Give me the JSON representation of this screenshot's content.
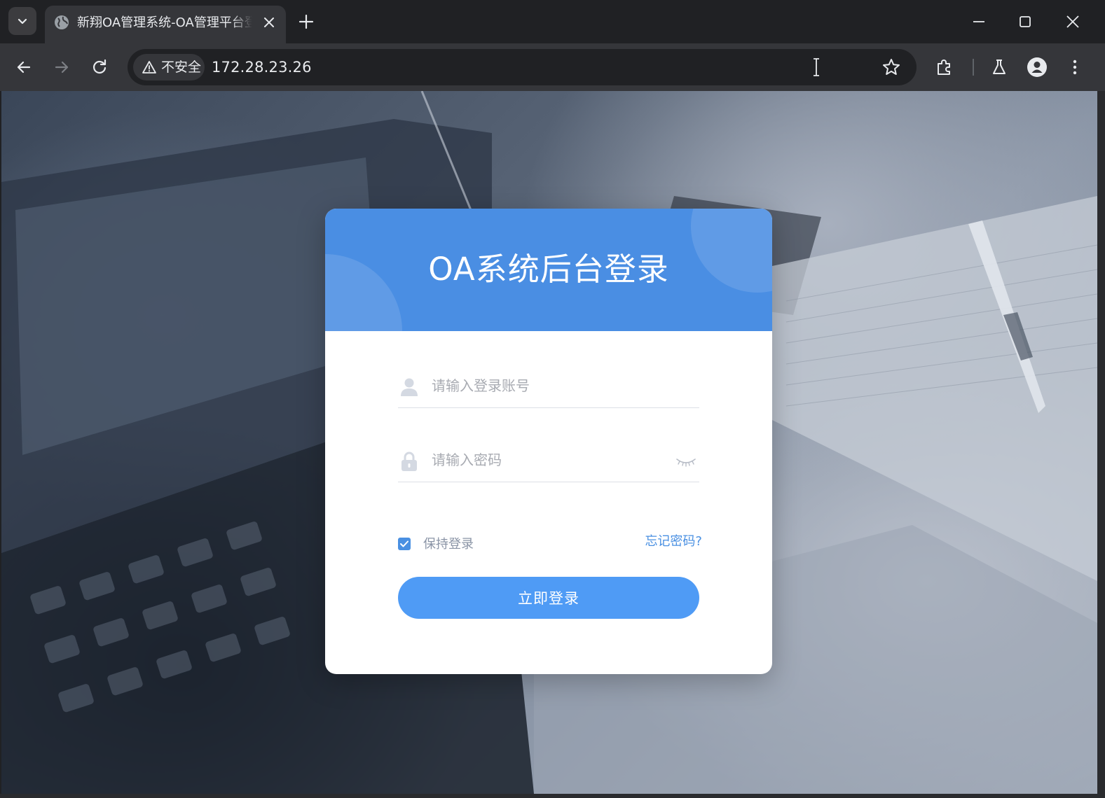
{
  "browser": {
    "tab": {
      "title": "新翔OA管理系统-OA管理平台登录"
    },
    "address_bar": {
      "security_label": "不安全",
      "url": "172.28.23.26"
    }
  },
  "login": {
    "title": "OA系统后台登录",
    "username": {
      "placeholder": "请输入登录账号",
      "value": ""
    },
    "password": {
      "placeholder": "请输入密码",
      "value": ""
    },
    "remember": {
      "label": "保持登录",
      "checked": true
    },
    "forgot_label": "忘记密码?",
    "submit_label": "立即登录"
  },
  "colors": {
    "header_blue": "#4a8ee3",
    "button_blue": "#4f9bf5",
    "link_blue": "#4a90e2",
    "browser_dark": "#202124",
    "toolbar": "#35363a"
  }
}
